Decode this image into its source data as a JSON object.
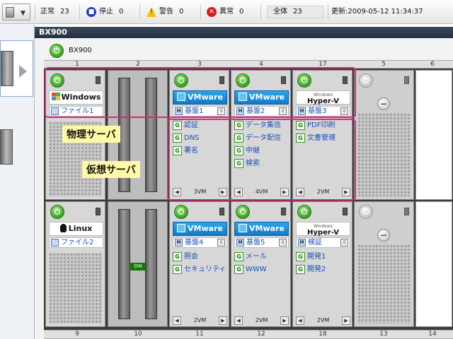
{
  "statusbar": {
    "normal_label": "正常",
    "normal_count": "23",
    "stopped_label": "停止",
    "stopped_count": "0",
    "warning_label": "警告",
    "warning_count": "0",
    "error_label": "異常",
    "error_count": "0",
    "total_label": "全体",
    "total_count": "23",
    "updated_label": "更新:",
    "updated_value": "2009-05-12 11:34:37"
  },
  "chassis": {
    "title": "BX900",
    "node_label": "BX900"
  },
  "slot_numbers_top": [
    "1",
    "2",
    "3",
    "4",
    "17",
    "5",
    "6"
  ],
  "slot_numbers_bottom": [
    "9",
    "10",
    "11",
    "12",
    "18",
    "13",
    "14"
  ],
  "blades": {
    "b1": {
      "logo": "Windows",
      "host": "ファイル1"
    },
    "b3": {
      "logo": "VMware",
      "host": "基盤1",
      "vms": [
        "認証",
        "DNS",
        "署名"
      ],
      "vm_count": "3VM"
    },
    "b4": {
      "logo": "VMware",
      "host": "基盤2",
      "vms": [
        "データ集信",
        "データ配信",
        "中継",
        "検索"
      ],
      "vm_count": "4VM"
    },
    "b17": {
      "logo_small": "Windows",
      "logo": "Hyper-V",
      "host": "基盤3",
      "vms": [
        "PDF印刷",
        "文書管理"
      ],
      "vm_count": "2VM"
    },
    "b9": {
      "logo": "Linux",
      "host": "ファイル2"
    },
    "b11": {
      "logo": "VMware",
      "host": "基盤4",
      "vms": [
        "照会",
        "セキュリティ"
      ],
      "vm_count": "2VM"
    },
    "b12": {
      "logo": "VMware",
      "host": "基盤5",
      "vms": [
        "メール",
        "WWW"
      ],
      "vm_count": "2VM"
    },
    "b18": {
      "logo_small": "Windows",
      "logo": "Hyper-V",
      "host": "検証",
      "vms": [
        "開発1",
        "開発2"
      ],
      "vm_count": "2VM"
    }
  },
  "storage": {
    "on_label": "ON"
  },
  "annotations": {
    "physical": "物理サーバ",
    "virtual": "仮想サーバ"
  },
  "colors": {
    "accent_pink": "#e0267e",
    "callout_yellow": "#fff9a8",
    "power_green": "#3aa023",
    "vmware_blue": "#1279c8"
  }
}
